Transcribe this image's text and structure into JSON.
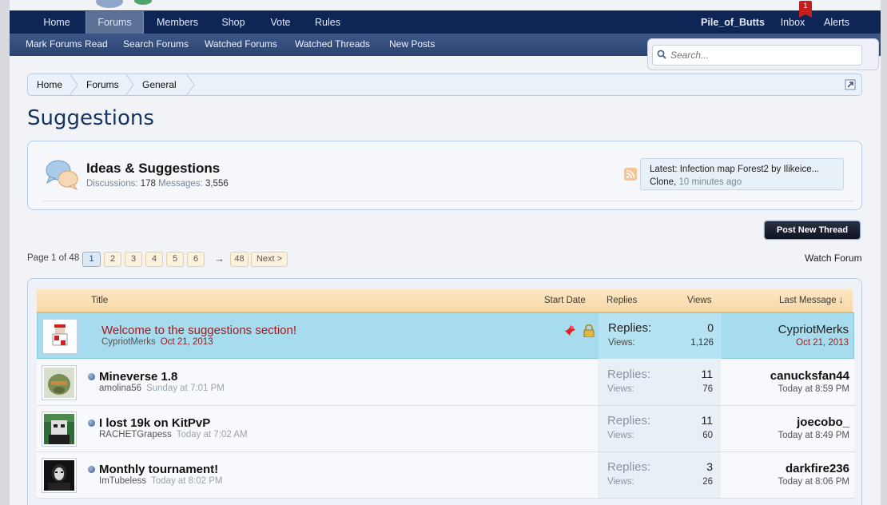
{
  "nav": {
    "tabs": [
      "Home",
      "Forums",
      "Members",
      "Shop",
      "Vote",
      "Rules"
    ],
    "active_tab": "Forums",
    "username": "Pile_of_Butts",
    "inbox_label": "Inbox",
    "inbox_count": "1",
    "alerts_label": "Alerts"
  },
  "subnav": {
    "links": [
      "Mark Forums Read",
      "Search Forums",
      "Watched Forums",
      "Watched Threads",
      "New Posts"
    ]
  },
  "search": {
    "placeholder": "Search..."
  },
  "breadcrumb": [
    "Home",
    "Forums",
    "General"
  ],
  "page_title": "Suggestions",
  "forum": {
    "name": "Ideas & Suggestions",
    "discussions_label": "Discussions:",
    "discussions": "178",
    "messages_label": "Messages:",
    "messages": "3,556",
    "latest_label": "Latest:",
    "latest_title": "Infection map Forest2 by Ilikeice...",
    "latest_user": "Clone",
    "latest_time": "10 minutes ago"
  },
  "post_thread_label": "Post New Thread",
  "pagination": {
    "label": "Page 1 of 48",
    "pages": [
      "1",
      "2",
      "3",
      "4",
      "5",
      "6"
    ],
    "current": "1",
    "arrow": "→",
    "last": "48",
    "next": "Next >"
  },
  "watch_forum": "Watch Forum",
  "list_header": {
    "title": "Title",
    "start_date": "Start Date",
    "replies": "Replies",
    "views": "Views",
    "last_message": "Last Message ↓"
  },
  "threads": [
    {
      "title": "Welcome to the suggestions section!",
      "author": "CypriotMerks",
      "date": "Oct 21, 2013",
      "replies_label": "Replies:",
      "replies": "0",
      "views_label": "Views:",
      "views": "1,126",
      "last_user": "CypriotMerks",
      "last_date": "Oct 21, 2013",
      "sticky": true
    },
    {
      "title": "Mineverse 1.8",
      "author": "amolina56",
      "date": "Sunday at 7:01 PM",
      "replies_label": "Replies:",
      "replies": "11",
      "views_label": "Views:",
      "views": "76",
      "last_user": "canucksfan44",
      "last_date": "Today at 8:59 PM",
      "sticky": false
    },
    {
      "title": "I lost 19k on KitPvP",
      "author": "RACHETGrapess",
      "date": "Today at 7:02 AM",
      "replies_label": "Replies:",
      "replies": "11",
      "views_label": "Views:",
      "views": "60",
      "last_user": "joecobo_",
      "last_date": "Today at 8:49 PM",
      "sticky": false
    },
    {
      "title": "Monthly tournament!",
      "author": "ImTubeless",
      "date": "Today at 8:02 PM",
      "replies_label": "Replies:",
      "replies": "3",
      "views_label": "Views:",
      "views": "26",
      "last_user": "darkfire236",
      "last_date": "Today at 8:06 PM",
      "sticky": false
    }
  ],
  "colors": {
    "nav_bg": "#0f2555",
    "subnav_bg": "#344d7d",
    "title_color": "#163560",
    "sticky_bg": "#a6dcee",
    "sticky_title": "#a41b1b",
    "header_bg": "#fbe0b5"
  },
  "icons": [
    "search-icon",
    "jump-to-page-icon",
    "chat-bubbles-icon",
    "rss-icon",
    "pin-icon",
    "lock-icon",
    "unread-dot-icon"
  ]
}
